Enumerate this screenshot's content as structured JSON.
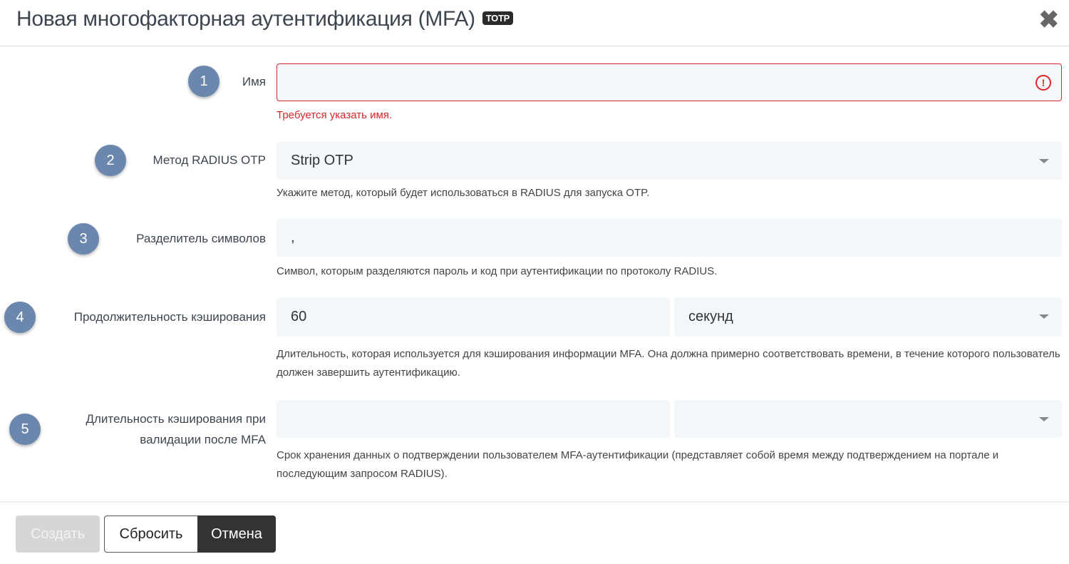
{
  "header": {
    "title": "Новая многофакторная аутентификация (MFA)",
    "badge": "TOTP",
    "close": "✖"
  },
  "fields": [
    {
      "step": "1",
      "label": "Имя",
      "value": "",
      "error": "Требуется указать имя."
    },
    {
      "step": "2",
      "label": "Метод RADIUS OTP",
      "value": "Strip OTP",
      "help": "Укажите метод, который будет использоваться в RADIUS для запуска OTP."
    },
    {
      "step": "3",
      "label": "Разделитель символов",
      "value": ",",
      "help": "Символ, которым разделяются пароль и код при аутентификации по протоколу RADIUS."
    },
    {
      "step": "4",
      "label": "Продолжительность кэширования",
      "value": "60",
      "unit": "секунд",
      "help": "Длительность, которая используется для кэширования информации MFA. Она должна примерно соответствовать времени, в течение которого пользователь должен завершить аутентификацию."
    },
    {
      "step": "5",
      "label": "Длительность кэширования при валидации после MFA",
      "value": "",
      "unit": "",
      "help": "Срок хранения данных о подтверждении пользователем MFA-аутентификации (представляет собой время между подтверждением на портале и последующим запросом RADIUS)."
    }
  ],
  "footer": {
    "create": "Создать",
    "reset": "Сбросить",
    "cancel": "Отмена"
  }
}
